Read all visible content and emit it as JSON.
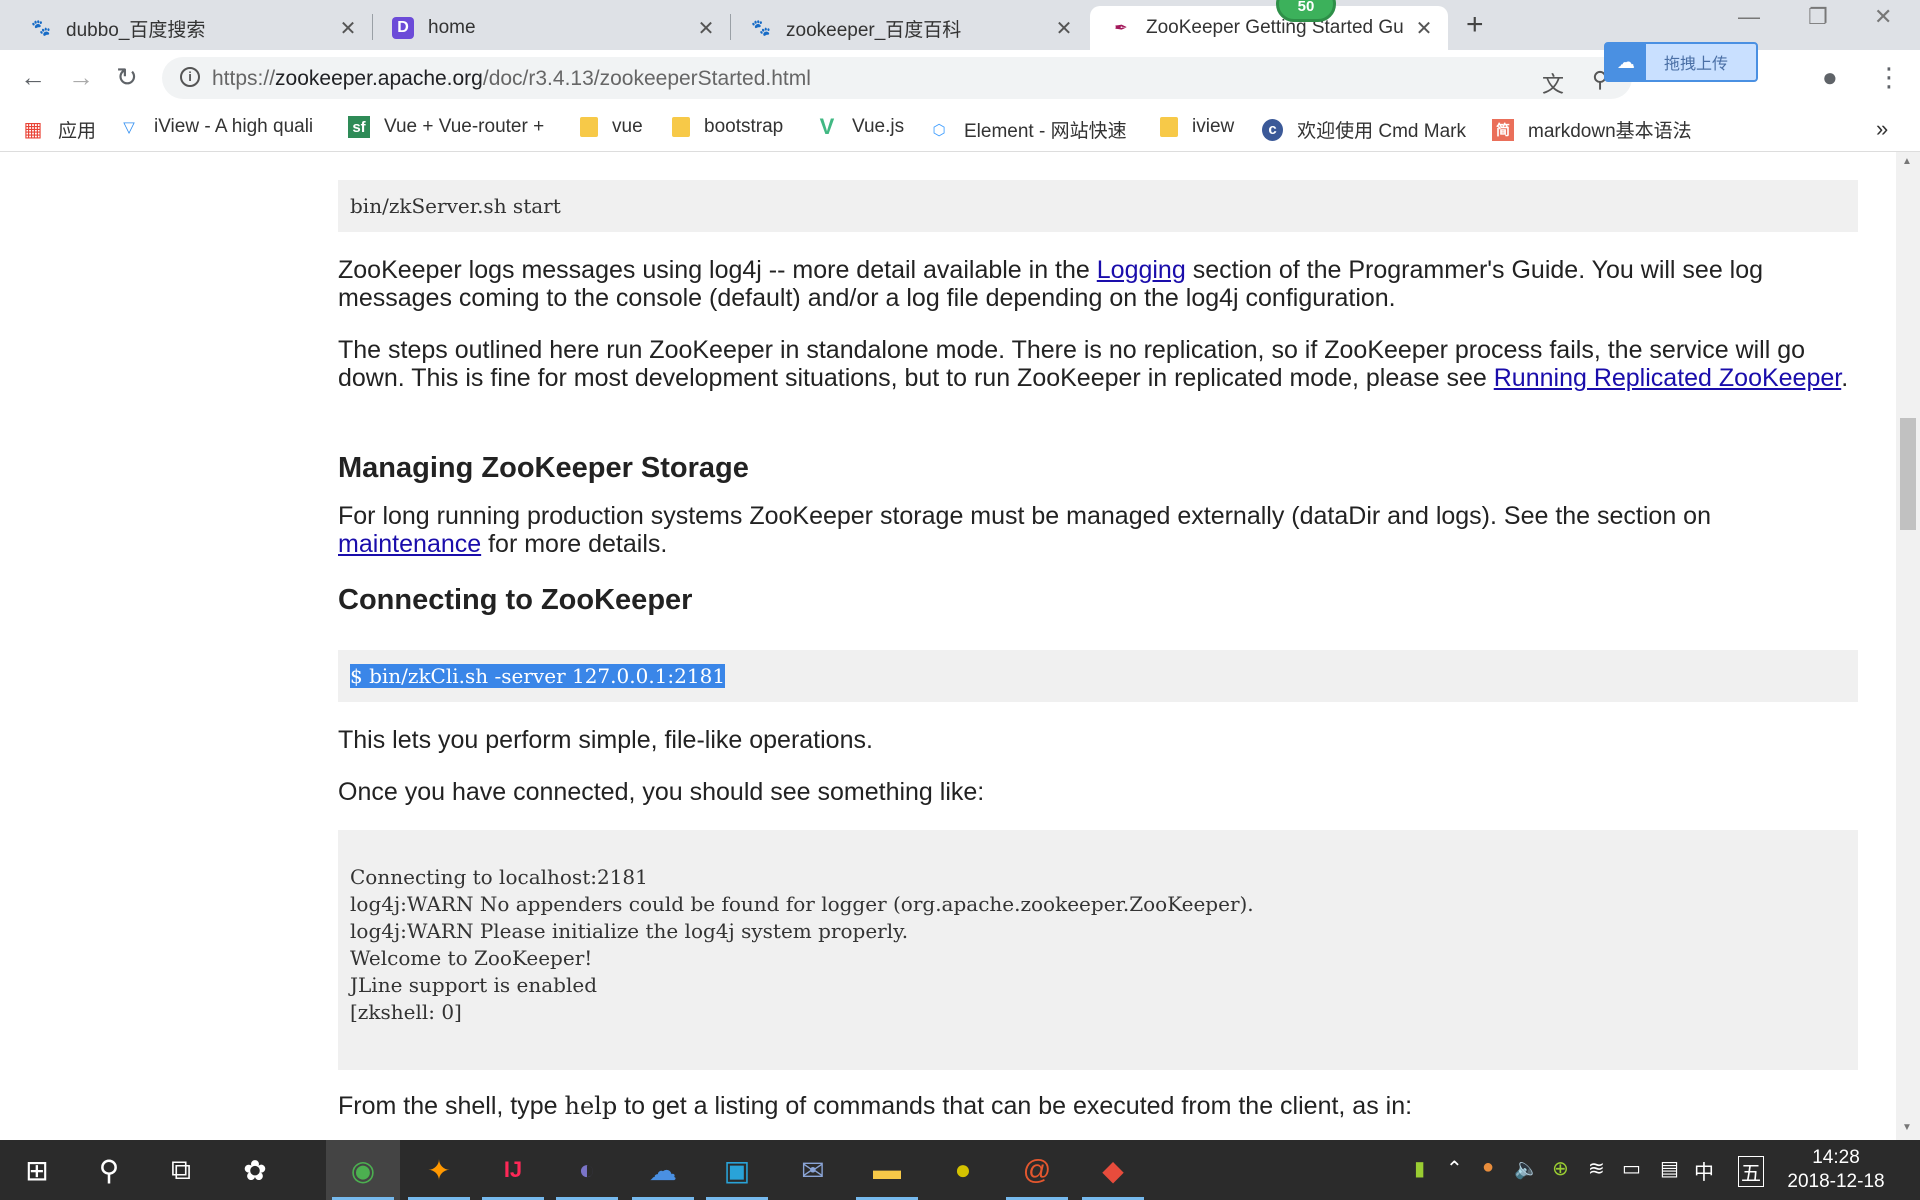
{
  "tabs": [
    {
      "title": "dubbo_百度搜索",
      "icon": "baidu-paw-icon"
    },
    {
      "title": "home",
      "icon": "d-logo-icon"
    },
    {
      "title": "zookeeper_百度百科",
      "icon": "baidu-paw-icon"
    },
    {
      "title": "ZooKeeper Getting Started Gu",
      "icon": "zookeeper-feather-icon"
    }
  ],
  "badge_count": "50",
  "url": {
    "scheme": "https://",
    "host": "zookeeper.apache.org",
    "path": "/doc/r3.4.13/zookeeperStarted.html"
  },
  "upload_label": "拖拽上传",
  "bookmarks": [
    {
      "label": "应用",
      "icon": "apps-grid-icon"
    },
    {
      "label": "iView - A high quali",
      "icon": "iview-icon"
    },
    {
      "label": "Vue + Vue-router +",
      "icon": "sf-icon"
    },
    {
      "label": "vue",
      "icon": "folder-icon"
    },
    {
      "label": "bootstrap",
      "icon": "folder-icon"
    },
    {
      "label": "Vue.js",
      "icon": "vue-icon"
    },
    {
      "label": "Element - 网站快速",
      "icon": "element-icon"
    },
    {
      "label": "iview",
      "icon": "folder-icon"
    },
    {
      "label": "欢迎使用 Cmd Mark",
      "icon": "cmd-markdown-icon"
    },
    {
      "label": "markdown基本语法",
      "icon": "jianshu-icon"
    }
  ],
  "doc": {
    "pre1": "bin/zkServer.sh start",
    "p1": {
      "a": "ZooKeeper logs messages using log4j -- more detail available in the ",
      "link": "Logging",
      "b": " section of the Programmer's Guide. You will see log messages coming to the console (default) and/or a log file depending on the log4j configuration."
    },
    "p2": {
      "a": "The steps outlined here run ZooKeeper in standalone mode. There is no replication, so if ZooKeeper process fails, the service will go down. This is fine for most development situations, but to run ZooKeeper in replicated mode, please see ",
      "link": "Running Replicated ZooKeeper",
      "b": "."
    },
    "h_storage": "Managing ZooKeeper Storage",
    "p3": {
      "a": "For long running production systems ZooKeeper storage must be managed externally (dataDir and logs). See the section on ",
      "link": "maintenance",
      "b": " for more details."
    },
    "h_connect": "Connecting to ZooKeeper",
    "pre2": "$ bin/zkCli.sh -server 127.0.0.1:2181",
    "p4": "This lets you perform simple, file-like operations.",
    "p5": "Once you have connected, you should see something like:",
    "pre3": [
      "Connecting to localhost:2181",
      "log4j:WARN No appenders could be found for logger (org.apache.zookeeper.ZooKeeper).",
      "log4j:WARN Please initialize the log4j system properly.",
      "Welcome to ZooKeeper!",
      "JLine support is enabled",
      "[zkshell: 0]"
    ],
    "p6": {
      "a": "From the shell, type ",
      "code": "help",
      "b": " to get a listing of commands that can be executed from the client, as in:"
    }
  },
  "tray": {
    "ime1": "中",
    "ime2": "五",
    "time": "14:28",
    "date": "2018-12-18"
  }
}
